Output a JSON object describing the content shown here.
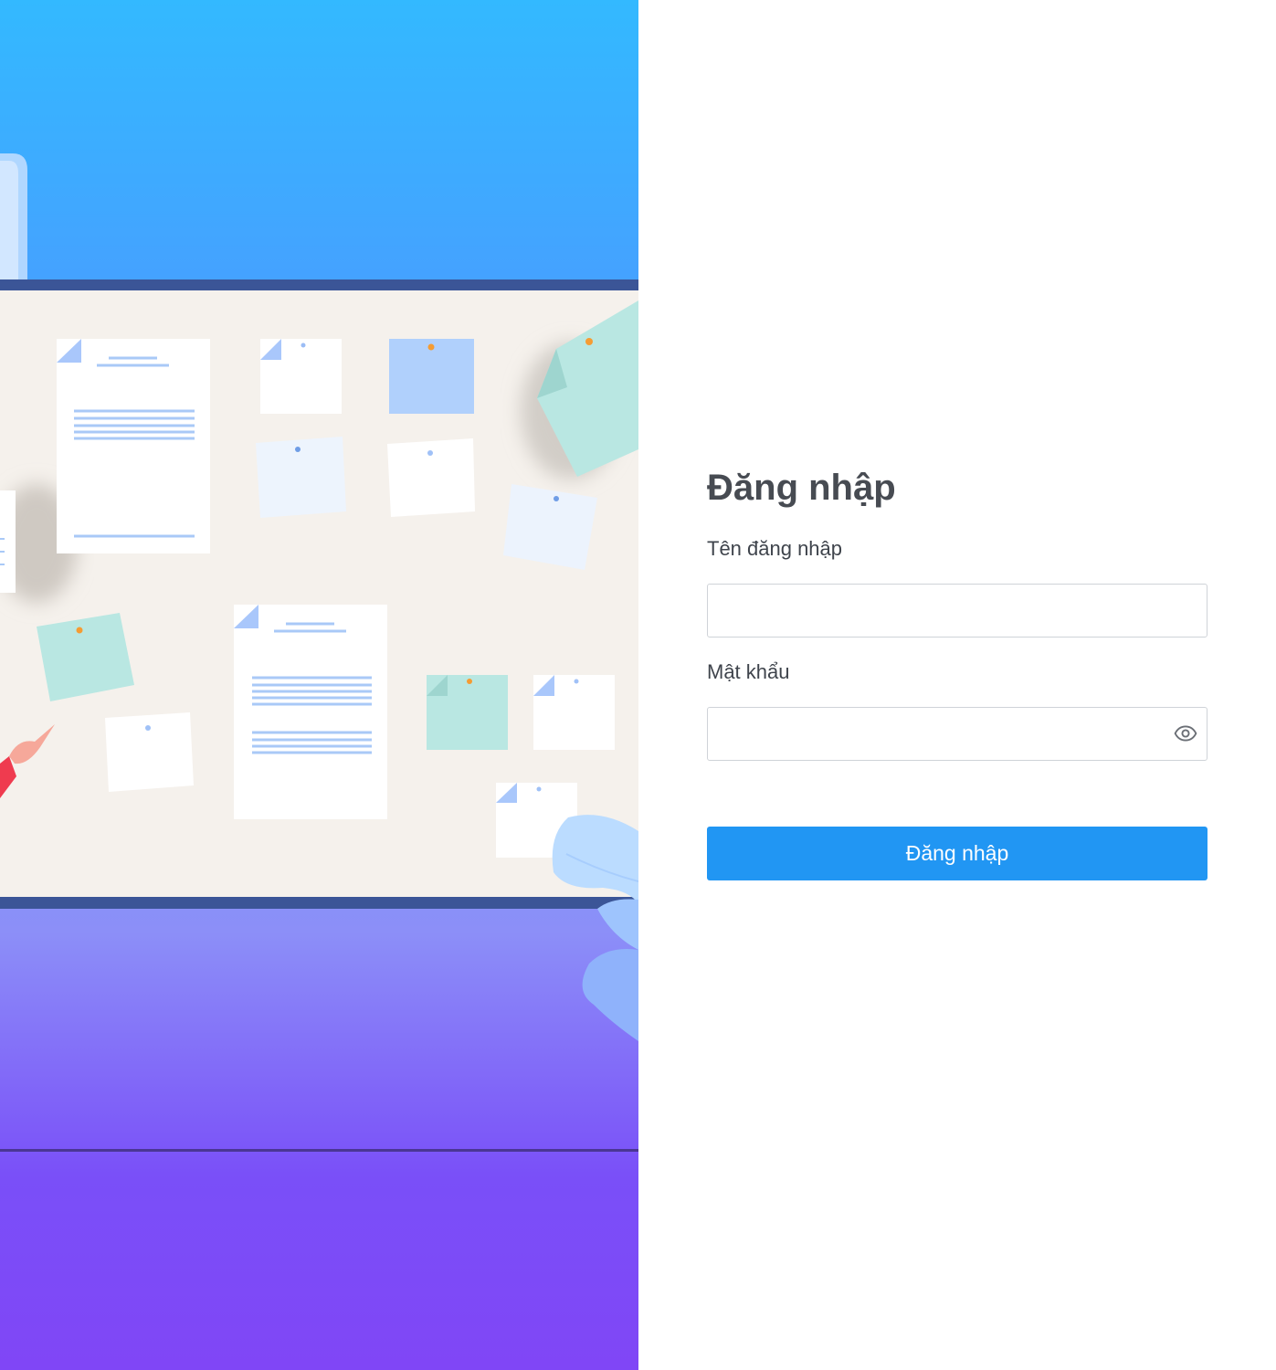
{
  "login_form": {
    "title": "Đăng nhập",
    "username": {
      "label": "Tên đăng nhập",
      "value": "",
      "placeholder": ""
    },
    "password": {
      "label": "Mật khẩu",
      "value": "",
      "placeholder": "",
      "toggle_icon": "eye-icon"
    },
    "submit_label": "Đăng nhập"
  },
  "colors": {
    "primary_button": "#2196f3",
    "title_text": "#474b52",
    "input_border": "#cfd3d8",
    "illustration_top": "#33b9ff",
    "illustration_bottom": "#8046f6"
  }
}
